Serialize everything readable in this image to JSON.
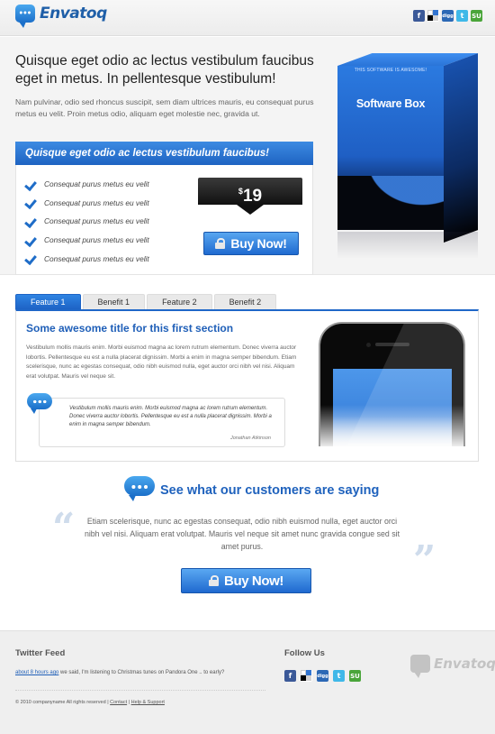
{
  "header": {
    "logo_text": "Envatoq",
    "social": [
      {
        "name": "facebook-icon",
        "glyph": "f"
      },
      {
        "name": "delicious-icon",
        "glyph": ""
      },
      {
        "name": "digg-icon",
        "glyph": "digg"
      },
      {
        "name": "twitter-icon",
        "glyph": "t"
      },
      {
        "name": "stumbleupon-icon",
        "glyph": "SU"
      }
    ]
  },
  "hero": {
    "title": "Quisque eget odio ac lectus vestibulum faucibus eget in metus. In pellentesque vestibulum!",
    "subtitle": "Nam pulvinar, odio sed rhoncus suscipit, sem diam ultrices mauris, eu consequat purus metus eu velit. Proin metus odio, aliquam eget molestie nec, gravida ut.",
    "bar_title": "Quisque eget odio ac lectus vestibulum faucibus!",
    "features": [
      "Consequat purus metus eu velit",
      "Consequat purus metus eu velit",
      "Consequat purus metus eu velit",
      "Consequat purus metus eu velit",
      "Consequat purus metus eu velit"
    ],
    "price_symbol": "$",
    "price_value": "19",
    "buy_label": "Buy Now!",
    "box_tagline": "THIS SOFTWARE IS AWESOME!",
    "box_name": "Software Box"
  },
  "tabs": [
    {
      "label": "Feature 1",
      "active": true
    },
    {
      "label": "Benefit 1",
      "active": false
    },
    {
      "label": "Feature 2",
      "active": false
    },
    {
      "label": "Benefit 2",
      "active": false
    }
  ],
  "section": {
    "title": "Some awesome title for this first section",
    "body": "Vestibulum mollis mauris enim. Morbi euismod magna ac lorem rutrum elementum. Donec viverra auctor lobortis. Pellentesque eu est a nulla placerat dignissim. Morbi a enim in magna semper bibendum. Etiam scelerisque, nunc ac egestas consequat, odio nibh euismod nulla, eget auctor orci nibh vel nisi. Aliquam erat volutpat. Mauris vel neque sit.",
    "quote": "Vestibulum mollis mauris enim. Morbi euismod magna ac lorem rutrum elementum. Donec viverra auctor lobortis. Pellentesque eu est a nulla placerat dignissim. Morbi a enim in magna semper bibendum.",
    "quote_author": "Jonathan Atkinson"
  },
  "testimonials": {
    "title": "See what our customers are saying",
    "text": "Etiam scelerisque, nunc ac egestas consequat, odio nibh euismod nulla, eget auctor orci nibh vel nisi. Aliquam erat volutpat. Mauris vel neque sit amet nunc gravida congue sed sit amet purus.",
    "buy_label": "Buy Now!"
  },
  "footer": {
    "twitter_heading": "Twitter Feed",
    "tweet_link": "about 8 hours ago",
    "tweet_text": " we said, I'm listening to Christmas tunes on Pandora One .. to early?",
    "follow_heading": "Follow Us",
    "copyright": "© 2010 companyname All rights reserved | ",
    "contact_label": "Contact",
    "divider": " | ",
    "help_label": "Help & Support",
    "logo_text": "Envatoq"
  },
  "colors": {
    "accent": "#1f63c5",
    "heading_blue": "#1f5fb8"
  }
}
